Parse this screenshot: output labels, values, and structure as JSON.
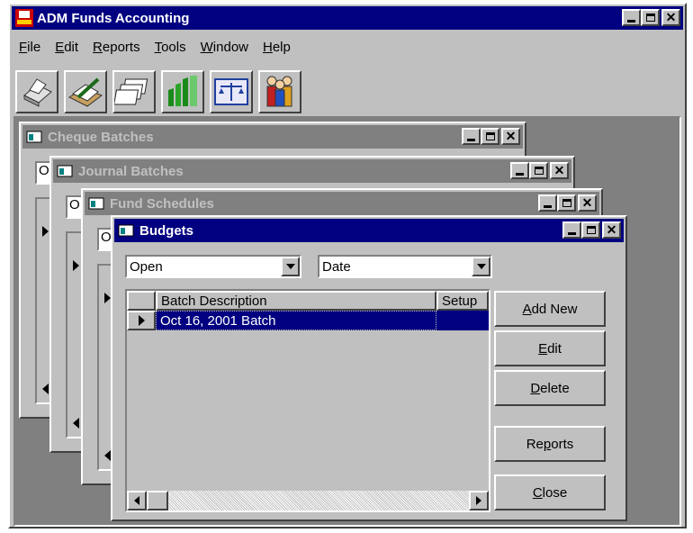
{
  "app": {
    "title": "ADM Funds Accounting",
    "menu": [
      {
        "key": "F",
        "rest": "ile"
      },
      {
        "key": "E",
        "rest": "dit"
      },
      {
        "key": "R",
        "rest": "eports"
      },
      {
        "key": "T",
        "rest": "ools"
      },
      {
        "key": "W",
        "rest": "indow"
      },
      {
        "key": "H",
        "rest": "elp"
      }
    ],
    "toolbar_icons": [
      "printer-icon",
      "journal-pen-icon",
      "cheque-stack-icon",
      "fund-chart-icon",
      "balance-scale-icon",
      "users-group-icon"
    ]
  },
  "windows": {
    "cheque_batches": {
      "title": "Cheque Batches",
      "field_prefix": "O"
    },
    "journal_batches": {
      "title": "Journal Batches",
      "field_prefix": "O"
    },
    "fund_schedules": {
      "title": "Fund Schedules",
      "field_prefix": "O"
    },
    "budgets": {
      "title": "Budgets",
      "status_filter": "Open",
      "sort_by": "Date",
      "columns": [
        "Batch Description",
        "Setup"
      ],
      "rows": [
        {
          "description": "Oct 16, 2001 Batch",
          "setup": ""
        }
      ],
      "buttons": {
        "add_new": {
          "key": "A",
          "rest": "dd New"
        },
        "edit": {
          "key": "E",
          "rest": "dit"
        },
        "delete": {
          "key": "D",
          "rest": "elete"
        },
        "reports": {
          "pre": "Re",
          "key": "p",
          "rest": "orts"
        },
        "close": {
          "key": "C",
          "rest": "lose"
        }
      }
    }
  },
  "colors": {
    "active_title": "#000080",
    "inactive_title": "#808080",
    "face": "#c0c0c0",
    "mdi_bg": "#808080"
  }
}
